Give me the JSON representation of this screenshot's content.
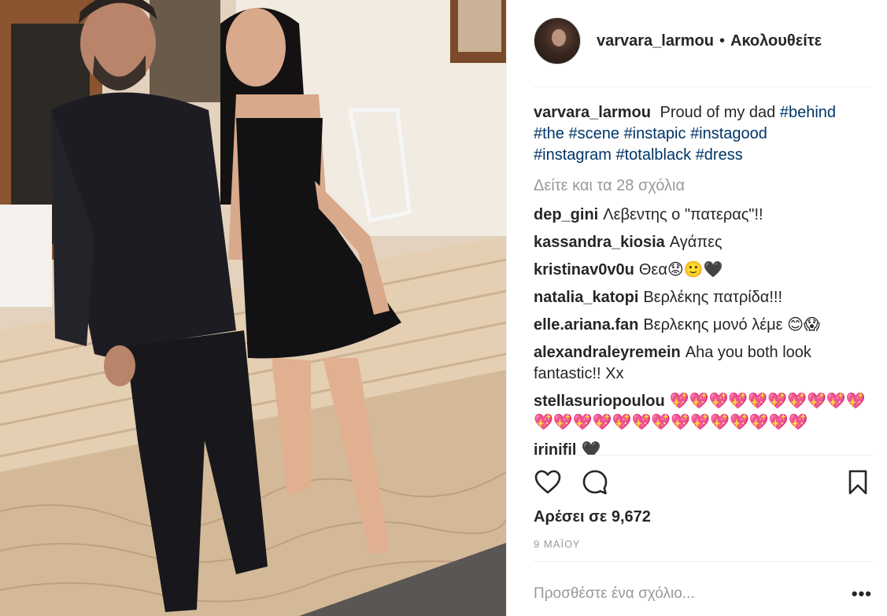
{
  "post": {
    "author": "varvara_larmou",
    "separator": "•",
    "follow_label": "Ακολουθείτε",
    "caption": {
      "username": "varvara_larmou",
      "text": "Proud of my dad",
      "hashtags": [
        "#behind",
        "#the",
        "#scene",
        "#instapic",
        "#instagood",
        "#instagram",
        "#totalblack",
        "#dress"
      ]
    },
    "view_all_comments": "Δείτε και τα 28 σχόλια",
    "comments": [
      {
        "username": "dep_gini",
        "text": "Λεβεντης ο \"πατερας\"!!"
      },
      {
        "username": "kassandra_kiosia",
        "text": "Αγάπες"
      },
      {
        "username": "kristinav0v0u",
        "text": "Θεα😟🙂🖤"
      },
      {
        "username": "natalia_katopi",
        "text": "Βερλέκης πατρίδα!!!"
      },
      {
        "username": "elle.ariana.fan",
        "text": "Βερλεκης μονό λέμε 😊😱"
      },
      {
        "username": "alexandraleyremein",
        "text": "Aha you both look fantastic!! Xx"
      },
      {
        "username": "stellasuriopoulou",
        "text": "💖💖💖💖💖💖💖💖💖💖💖💖💖💖💖💖💖💖💖💖💖💖💖💖"
      },
      {
        "username": "irinifil",
        "text": "🖤"
      }
    ],
    "likes_text": "Αρέσει σε 9,672",
    "date": "9 ΜΑΪΟΥ",
    "add_comment_placeholder": "Προσθέστε ένα σχόλιο...",
    "more_options": "•••"
  },
  "icons": {
    "like": "heart-outline-icon",
    "comment": "speech-bubble-icon",
    "save": "bookmark-icon"
  },
  "colors": {
    "hashtag": "#003569",
    "muted": "#999999",
    "text": "#262626",
    "divider": "#efefef"
  }
}
